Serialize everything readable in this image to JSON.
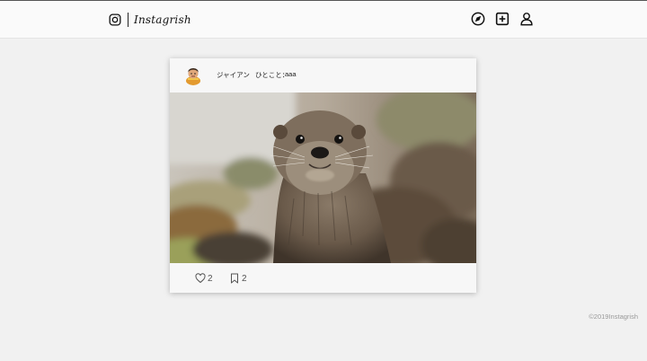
{
  "app": {
    "name": "Instagrish",
    "brand_icon": "instagram-icon"
  },
  "header": {
    "nav": [
      {
        "icon": "compass-icon",
        "name": "explore"
      },
      {
        "icon": "plus-square-icon",
        "name": "new-post"
      },
      {
        "icon": "user-icon",
        "name": "profile"
      }
    ]
  },
  "post": {
    "username": "ジャイアン",
    "caption_label": "ひとこと：",
    "caption": "aaa",
    "image": "otter-photo",
    "likes": "2",
    "bookmarks": "2",
    "like_icon": "heart-icon",
    "bookmark_icon": "bookmark-icon"
  },
  "footer": {
    "copyright": "©2019Instagrish"
  },
  "colors": {
    "background": "#f1f1f1",
    "header": "#fafafa",
    "card": "#f7f7f7",
    "muted_text": "#999999"
  }
}
